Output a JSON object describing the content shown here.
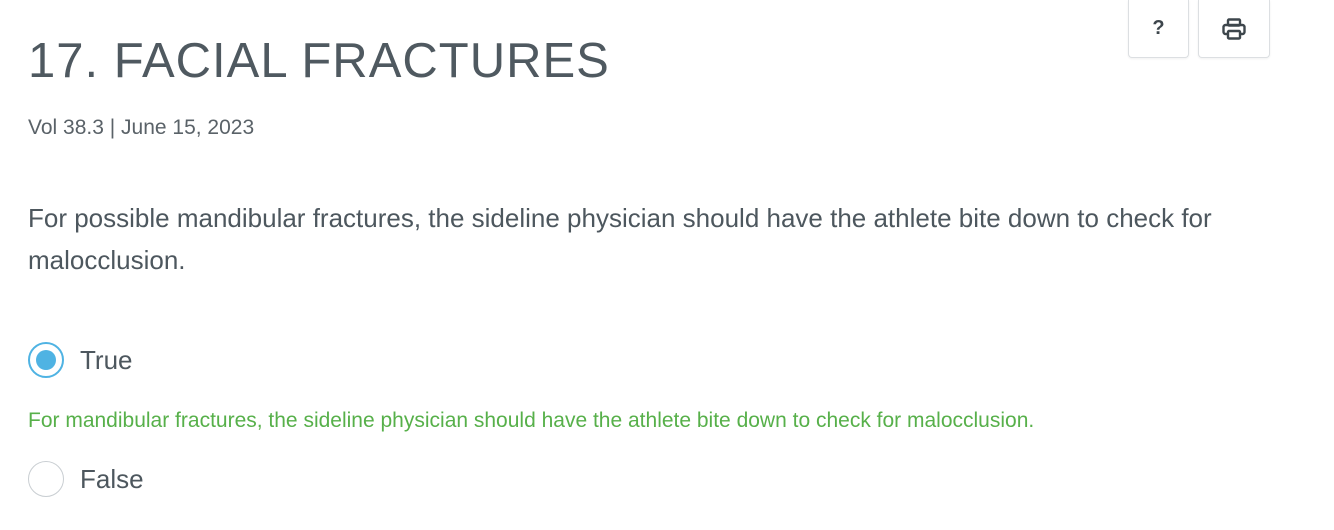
{
  "header": {
    "title": "17. FACIAL FRACTURES",
    "meta": "Vol 38.3 | June 15, 2023"
  },
  "toolbar": {
    "help_glyph": "?",
    "help_icon": "question-mark-icon",
    "print_icon": "printer-icon"
  },
  "question": {
    "text": "For possible mandibular fractures, the sideline physician should have the athlete bite down to check for malocclusion.",
    "options": [
      {
        "label": "True",
        "selected": true
      },
      {
        "label": "False",
        "selected": false
      }
    ],
    "feedback": "For mandibular fractures, the sideline physician should have the athlete bite down to check for malocclusion."
  },
  "colors": {
    "accent": "#4fb3e3",
    "feedback": "#57b04a",
    "text": "#4d575e"
  }
}
